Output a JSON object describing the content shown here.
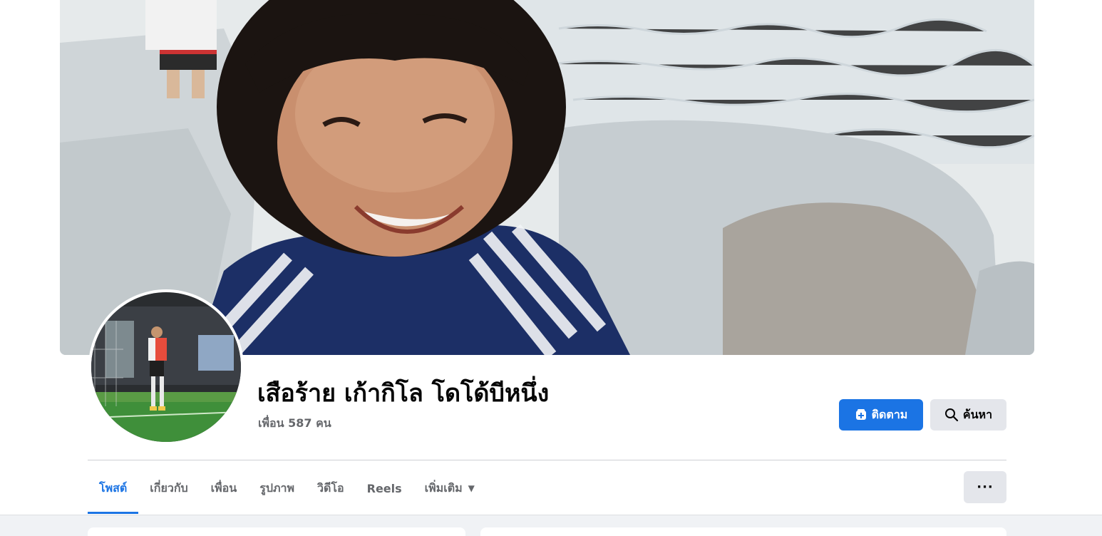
{
  "profile": {
    "name": "เสือร้าย เก้ากิโล โดโด้บีหนึ่ง",
    "friends": "เพื่อน 587 คน"
  },
  "actions": {
    "follow_label": "ติดตาม",
    "search_label": "ค้นหา",
    "more_label": "···"
  },
  "tabs": [
    {
      "label": "โพสต์",
      "active": true
    },
    {
      "label": "เกี่ยวกับ",
      "active": false
    },
    {
      "label": "เพื่อน",
      "active": false
    },
    {
      "label": "รูปภาพ",
      "active": false
    },
    {
      "label": "วิดีโอ",
      "active": false
    },
    {
      "label": "Reels",
      "active": false
    },
    {
      "label": "เพิ่มเติม",
      "active": false
    }
  ],
  "icons": {
    "follow": "follow-plus-icon",
    "search": "search-icon",
    "dropdown": "caret-down-icon",
    "more": "more-dots-icon"
  },
  "colors": {
    "accent": "#1b74e4",
    "text_primary": "#050505",
    "text_secondary": "#65676b",
    "button_secondary": "#e4e6eb",
    "feed_background": "#f0f2f5"
  }
}
